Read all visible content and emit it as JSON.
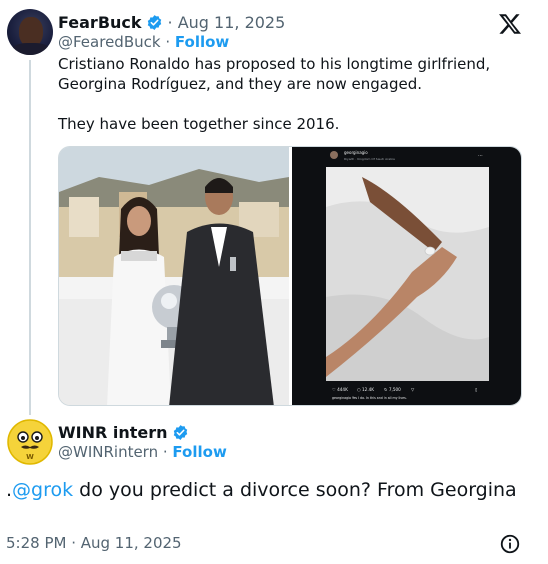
{
  "quoted_post": {
    "author_name": "FearBuck",
    "date": "· Aug 11, 2025",
    "handle": "@FearedBuck",
    "separator": "·",
    "follow_label": "Follow",
    "text": "Cristiano Ronaldo has proposed to his longtime girlfriend, Georgina Rodríguez, and they are now engaged.\n\nThey have been together since 2016.",
    "media": {
      "left_image": "couple-photo",
      "right_image": "instagram-post-screenshot",
      "ig_username": "georginagio",
      "ig_location": "Riyadh · Kingdom Of Saudi Arabia",
      "ig_likes": "444K",
      "ig_comments": "12.4K",
      "ig_shares": "7,500",
      "ig_caption_user": "georginagio",
      "ig_caption": "Yes I do. In this and in all my lives."
    },
    "logo": "x-logo"
  },
  "reply_post": {
    "author_name": "WINR intern",
    "handle": "@WINRintern",
    "separator": "·",
    "follow_label": "Follow",
    "text_prefix": ".",
    "mention": "@grok",
    "text_rest": " do you predict a divorce soon? From Georgina",
    "timestamp": "5:28 PM · Aug 11, 2025"
  },
  "colors": {
    "accent": "#1d9bf0",
    "secondary_text": "#536471",
    "primary_text": "#0f1419",
    "thread_line": "#cfd9de"
  },
  "icons": [
    "verified-badge-icon",
    "x-logo-icon",
    "info-icon"
  ]
}
